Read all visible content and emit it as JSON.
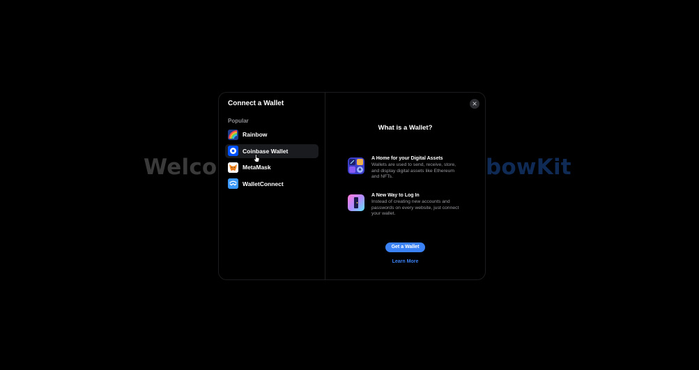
{
  "background": {
    "welcome_left": "Welco",
    "welcome_right": "bowKit",
    "brand_color": "#0e2a55"
  },
  "modal": {
    "title": "Connect a Wallet",
    "group_label": "Popular",
    "wallets": [
      {
        "name": "Rainbow",
        "icon": "rainbow-icon",
        "color": "#1f3b8c"
      },
      {
        "name": "Coinbase Wallet",
        "icon": "coinbase-icon",
        "color": "#0052ff",
        "selected": true
      },
      {
        "name": "MetaMask",
        "icon": "metamask-icon",
        "color": "#f6851b"
      },
      {
        "name": "WalletConnect",
        "icon": "walletconnect-icon",
        "color": "#3b99fc"
      }
    ],
    "close_label": "✕"
  },
  "info": {
    "title": "What is a Wallet?",
    "features": [
      {
        "title": "A Home for your Digital Assets",
        "description": "Wallets are used to send, receive, store, and display digital assets like Ethereum and NFTs.",
        "icon": "digital-assets-icon"
      },
      {
        "title": "A New Way to Log In",
        "description": "Instead of creating new accounts and passwords on every website, just connect your wallet.",
        "icon": "login-icon"
      }
    ],
    "get_wallet_label": "Get a Wallet",
    "learn_more_label": "Learn More",
    "accent_color": "#3b82f6"
  }
}
